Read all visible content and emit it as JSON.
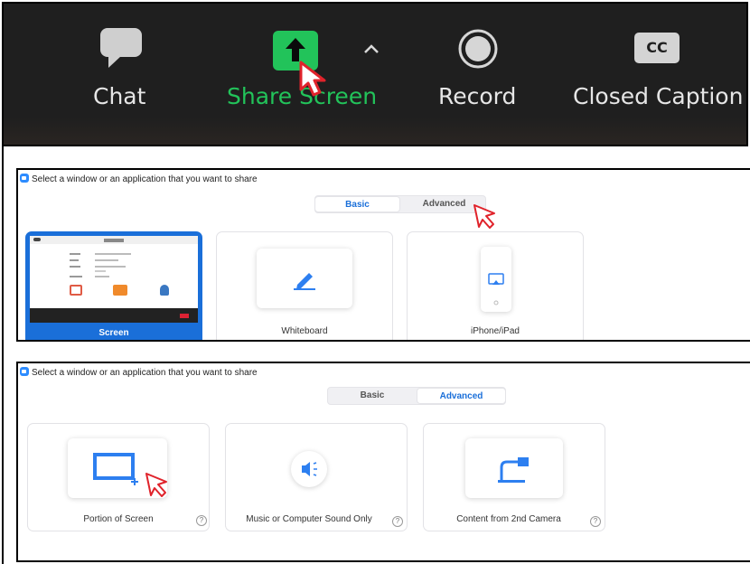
{
  "toolbar": {
    "items": [
      {
        "label": "Chat",
        "icon": "chat-bubble-icon"
      },
      {
        "label": "Share Screen",
        "icon": "share-screen-arrow-icon",
        "color": "#22c35a"
      },
      {
        "label": "Record",
        "icon": "record-circle-icon"
      },
      {
        "label": "Closed Caption",
        "icon": "cc-icon",
        "badge": "CC"
      }
    ],
    "expand_icon": "chevron-up-icon"
  },
  "basic_panel": {
    "title": "Select a window or an application that you want to share",
    "tabs": [
      {
        "label": "Basic",
        "selected": true
      },
      {
        "label": "Advanced",
        "selected": false
      }
    ],
    "cards": [
      {
        "label": "Screen",
        "selected": true,
        "icon": "screen-thumbnail"
      },
      {
        "label": "Whiteboard",
        "selected": false,
        "icon": "pen-icon"
      },
      {
        "label": "iPhone/iPad",
        "selected": false,
        "icon": "iphone-airplay-icon"
      }
    ]
  },
  "advanced_panel": {
    "title": "Select a window or an application that you want to share",
    "tabs": [
      {
        "label": "Basic",
        "selected": false
      },
      {
        "label": "Advanced",
        "selected": true
      }
    ],
    "cards": [
      {
        "label": "Portion of Screen",
        "icon": "portion-of-screen-icon",
        "help": "?"
      },
      {
        "label": "Music or Computer Sound Only",
        "icon": "speaker-icon",
        "help": "?"
      },
      {
        "label": "Content from 2nd Camera",
        "icon": "camera-icon",
        "help": "?"
      }
    ]
  },
  "colors": {
    "accent": "#1a6fd9",
    "zoom_blue": "#2d8cff",
    "share_green": "#22c35a",
    "cursor_red": "#e0232b"
  }
}
